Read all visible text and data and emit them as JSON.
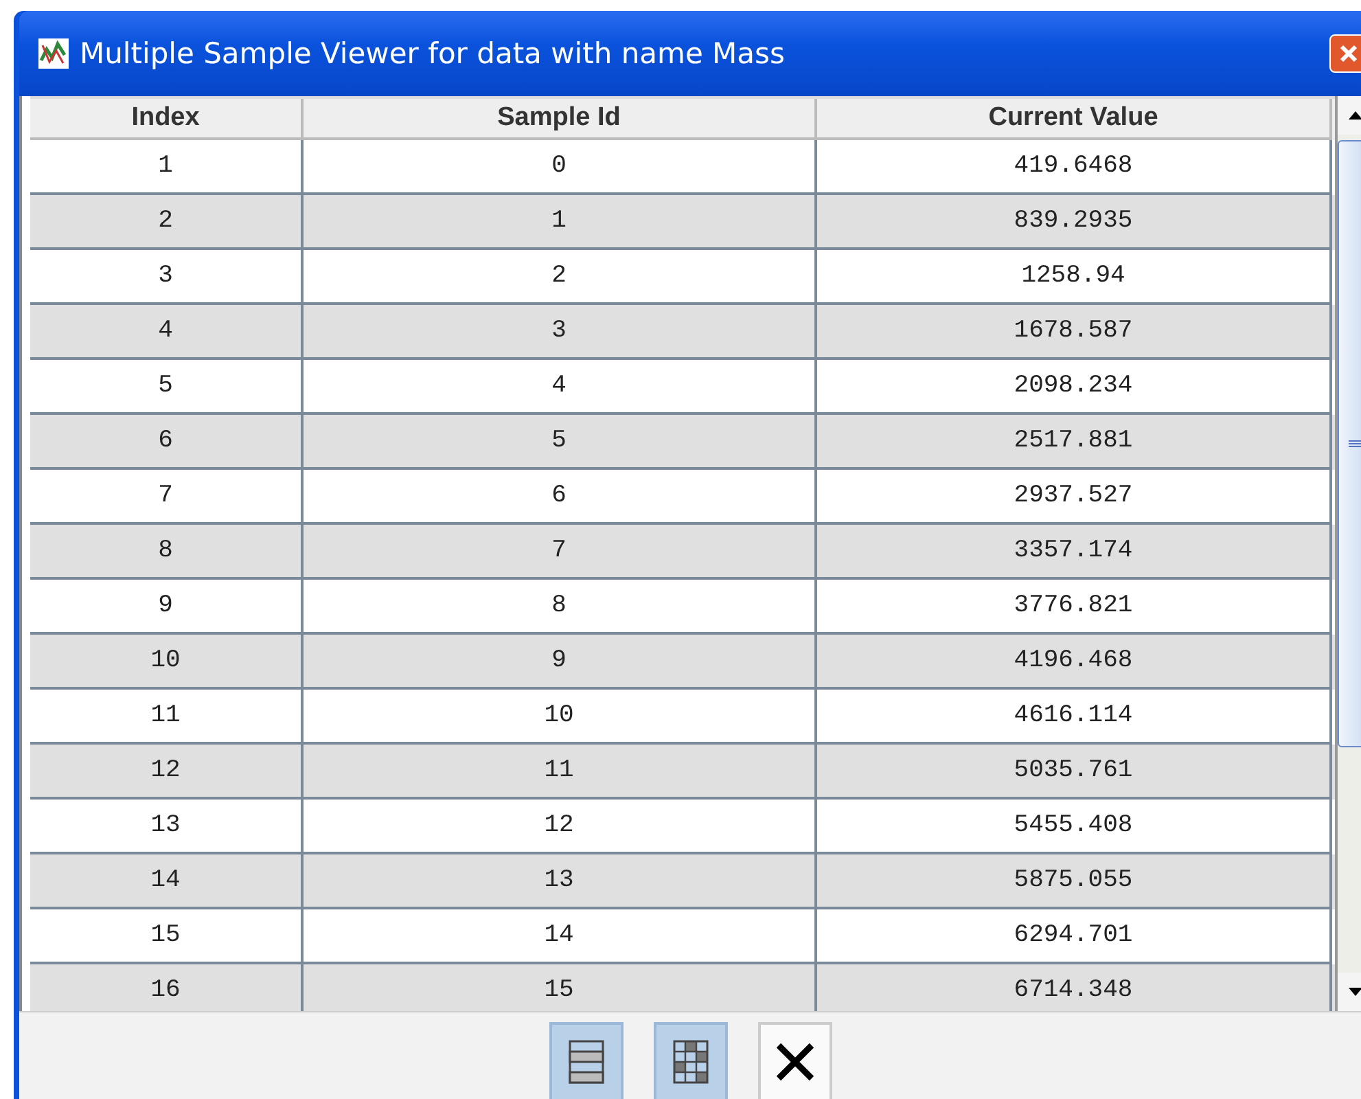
{
  "window": {
    "title": "Multiple Sample Viewer for data with name Mass"
  },
  "table": {
    "columns": [
      "Index",
      "Sample Id",
      "Current Value"
    ],
    "rows": [
      [
        "1",
        "0",
        "419.6468"
      ],
      [
        "2",
        "1",
        "839.2935"
      ],
      [
        "3",
        "2",
        "1258.94"
      ],
      [
        "4",
        "3",
        "1678.587"
      ],
      [
        "5",
        "4",
        "2098.234"
      ],
      [
        "6",
        "5",
        "2517.881"
      ],
      [
        "7",
        "6",
        "2937.527"
      ],
      [
        "8",
        "7",
        "3357.174"
      ],
      [
        "9",
        "8",
        "3776.821"
      ],
      [
        "10",
        "9",
        "4196.468"
      ],
      [
        "11",
        "10",
        "4616.114"
      ],
      [
        "12",
        "11",
        "5035.761"
      ],
      [
        "13",
        "12",
        "5455.408"
      ],
      [
        "14",
        "13",
        "5875.055"
      ],
      [
        "15",
        "14",
        "6294.701"
      ],
      [
        "16",
        "15",
        "6714.348"
      ]
    ]
  },
  "toolbar": [
    {
      "kind": "rows",
      "selected": true
    },
    {
      "kind": "grid",
      "selected": true
    },
    {
      "kind": "close",
      "selected": false
    }
  ]
}
